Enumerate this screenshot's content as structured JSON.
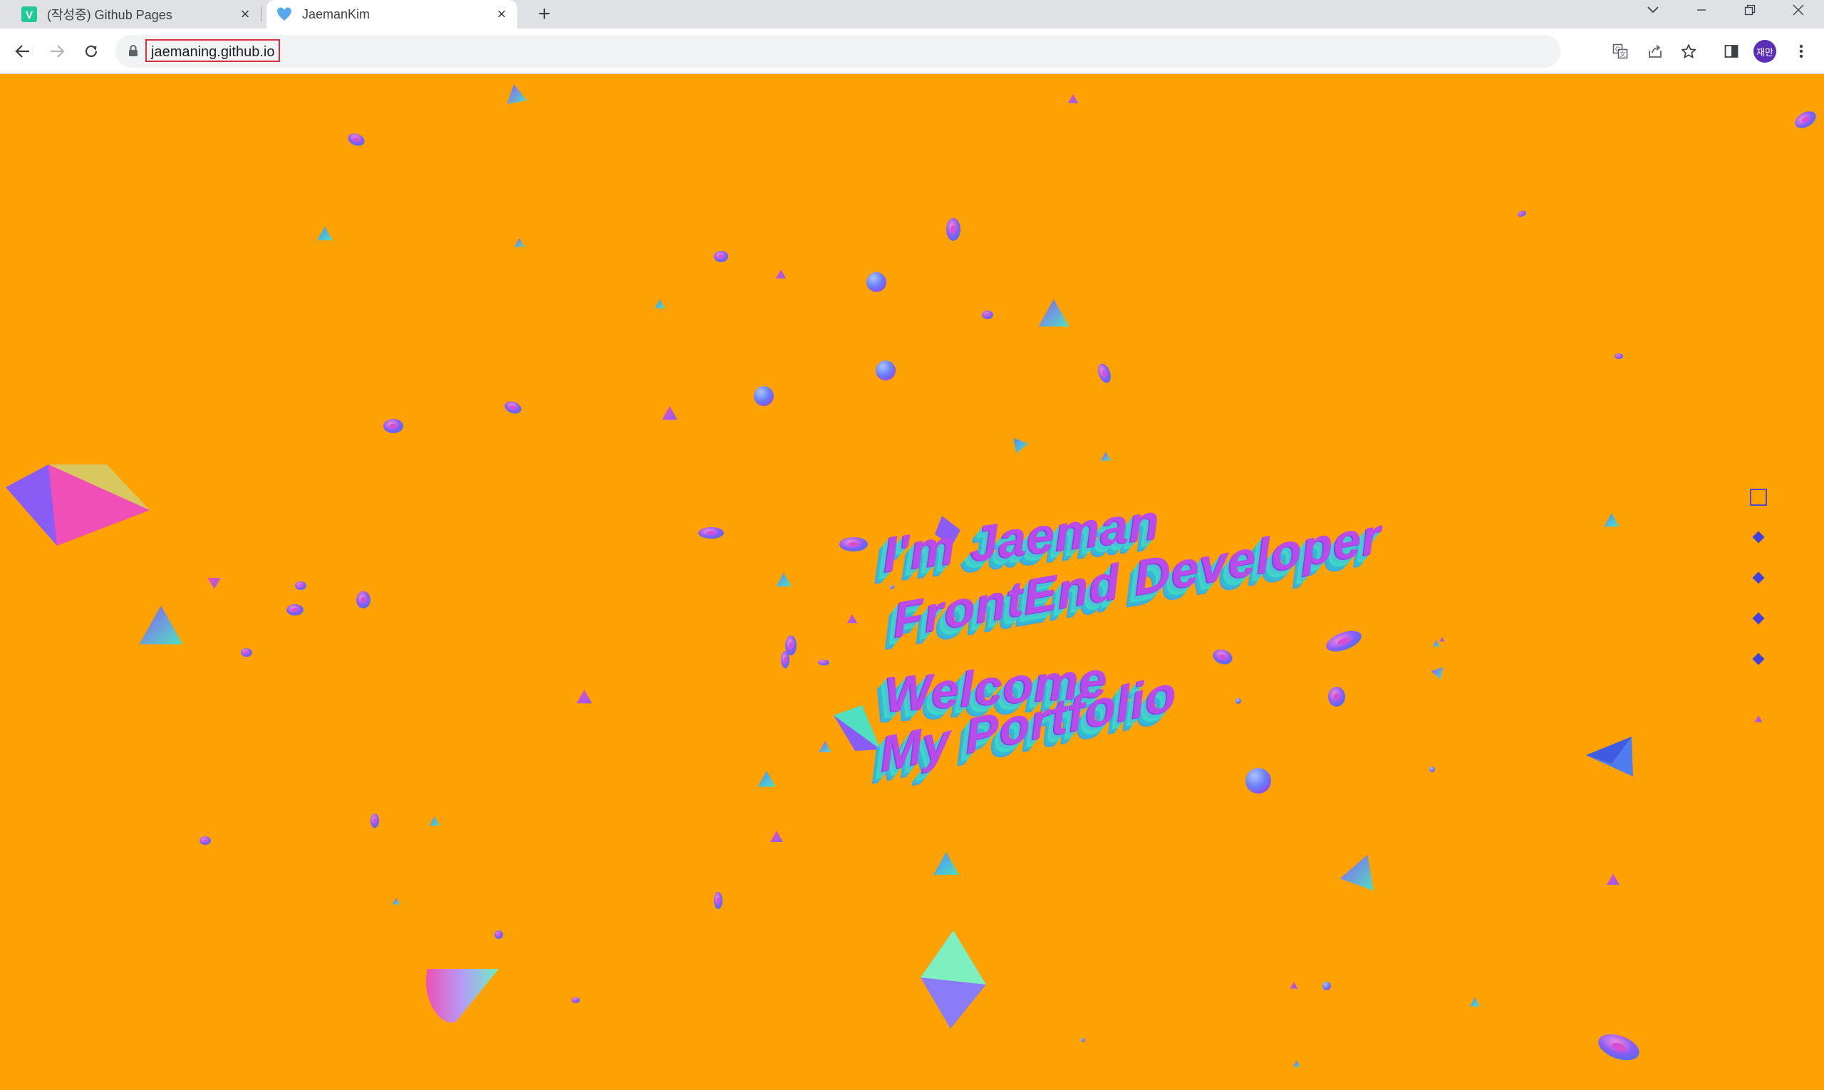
{
  "browser": {
    "tabs": [
      {
        "title": "(작성중) Github Pages",
        "active": false,
        "icon": "v-favicon"
      },
      {
        "title": "JaemanKim",
        "active": true,
        "icon": "blue-heart-favicon"
      }
    ],
    "new_tab_label": "+",
    "url": "jaemaning.github.io",
    "profile_initials": "재만"
  },
  "page": {
    "background_color": "#fea102",
    "hero_lines": [
      "I'm Jaeman",
      "FrontEnd Developer",
      "Welcome",
      "My Portfolio"
    ],
    "section_nav": {
      "active_index": 0,
      "count": 5
    }
  },
  "colors": {
    "text_face": "#b84bea",
    "text_side": "#3fd6c6",
    "shape_purple": "#8a5cf6",
    "shape_pink": "#f04fb8",
    "shape_teal": "#4fe0c0",
    "shape_blue": "#4f8cf6"
  }
}
